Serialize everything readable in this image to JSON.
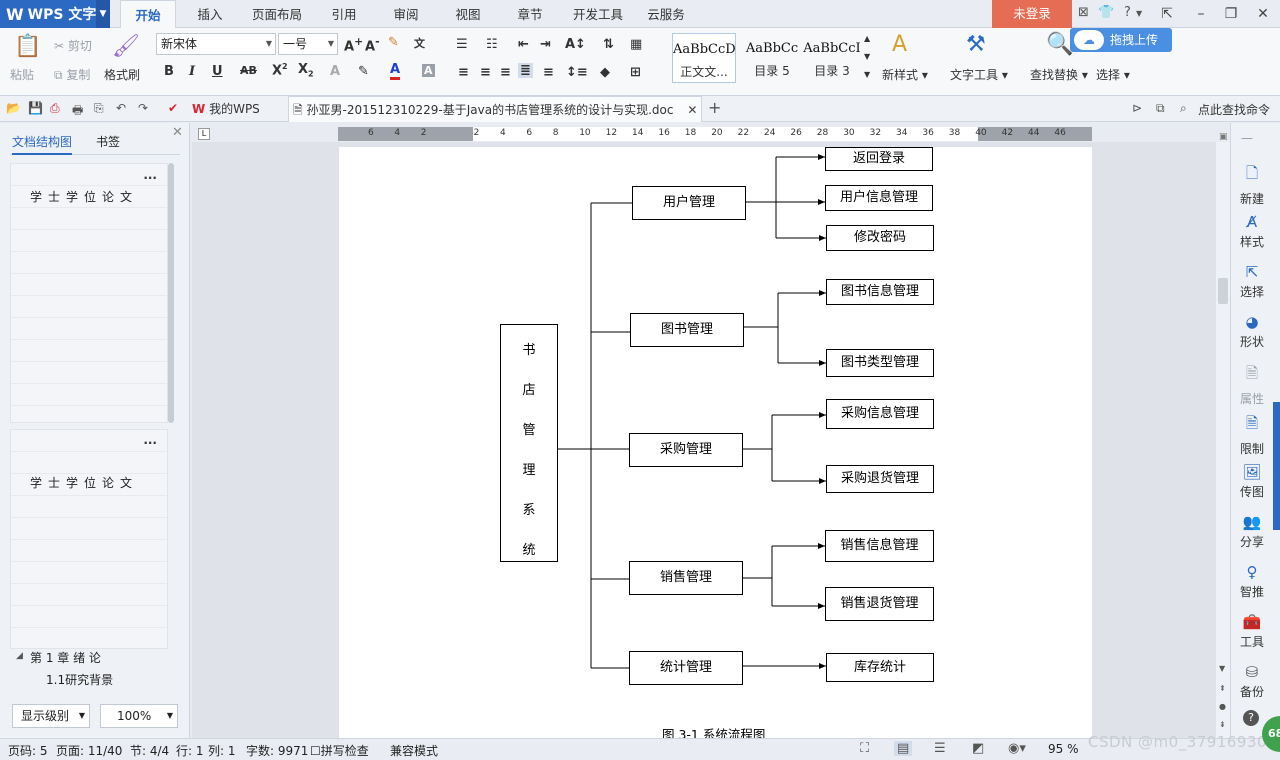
{
  "app": {
    "name": "WPS 文字",
    "login": "未登录"
  },
  "menu": {
    "tabs": [
      "开始",
      "插入",
      "页面布局",
      "引用",
      "审阅",
      "视图",
      "章节",
      "开发工具",
      "云服务"
    ],
    "active": "开始"
  },
  "ribbon": {
    "paste": "粘贴",
    "cut": "剪切",
    "copy": "复制",
    "format_painter": "格式刷",
    "font_name": "新宋体",
    "font_size": "一号",
    "styles": [
      {
        "sample": "AaBbCcD",
        "name": "正文文..."
      },
      {
        "sample": "AaBbCc",
        "name": "目录 5"
      },
      {
        "sample": "AaBbCcI",
        "name": "目录 3"
      }
    ],
    "new_style": "新样式",
    "text_tools": "文字工具",
    "find_replace": "查找替换",
    "select": "选择",
    "cloud_upload": "拖拽上传"
  },
  "tabs": {
    "home": "我的WPS",
    "document": "孙亚男-201512310229-基于Java的书店管理系统的设计与实现.doc",
    "search": "点此查找命令"
  },
  "leftpane": {
    "tab_outline": "文档结构图",
    "tab_bookmark": "书签",
    "heading1": "学士学位论文",
    "heading2": "学士学位论文",
    "dots": "...",
    "toc": [
      {
        "label": "第 1 章  绪   论"
      },
      {
        "label": "1.1研究背景"
      }
    ],
    "show_level": "显示级别",
    "zoom": "100%"
  },
  "ruler": {
    "numbers": [
      "6",
      "4",
      "2",
      "",
      "2",
      "4",
      "6",
      "8",
      "10",
      "12",
      "14",
      "16",
      "18",
      "20",
      "22",
      "24",
      "26",
      "28",
      "30",
      "32",
      "34",
      "36",
      "38",
      "40",
      "42",
      "44",
      "46"
    ]
  },
  "flowchart": {
    "root": "书店管理系统",
    "modules": [
      {
        "name": "用户管理",
        "children": [
          "返回登录",
          "用户信息管理",
          "修改密码"
        ]
      },
      {
        "name": "图书管理",
        "children": [
          "图书信息管理",
          "图书类型管理"
        ]
      },
      {
        "name": "采购管理",
        "children": [
          "采购信息管理",
          "采购退货管理"
        ]
      },
      {
        "name": "销售管理",
        "children": [
          "销售信息管理",
          "销售退货管理"
        ]
      },
      {
        "name": "统计管理",
        "children": [
          "库存统计"
        ]
      }
    ],
    "caption": "图 3-1 系统流程图"
  },
  "rightpane": {
    "tools": [
      "新建",
      "样式",
      "选择",
      "形状",
      "属性",
      "限制",
      "传图",
      "分享",
      "智推",
      "工具",
      "备份"
    ]
  },
  "status": {
    "page_no": "页码: 5",
    "pages": "页面: 11/40",
    "section": "节: 4/4",
    "row": "行: 1",
    "col": "列: 1",
    "words": "字数: 9971",
    "spellcheck": "拼写检查",
    "compat": "兼容模式",
    "zoom": "95 %"
  },
  "watermark": "CSDN @m0_37916930",
  "badge": "68"
}
